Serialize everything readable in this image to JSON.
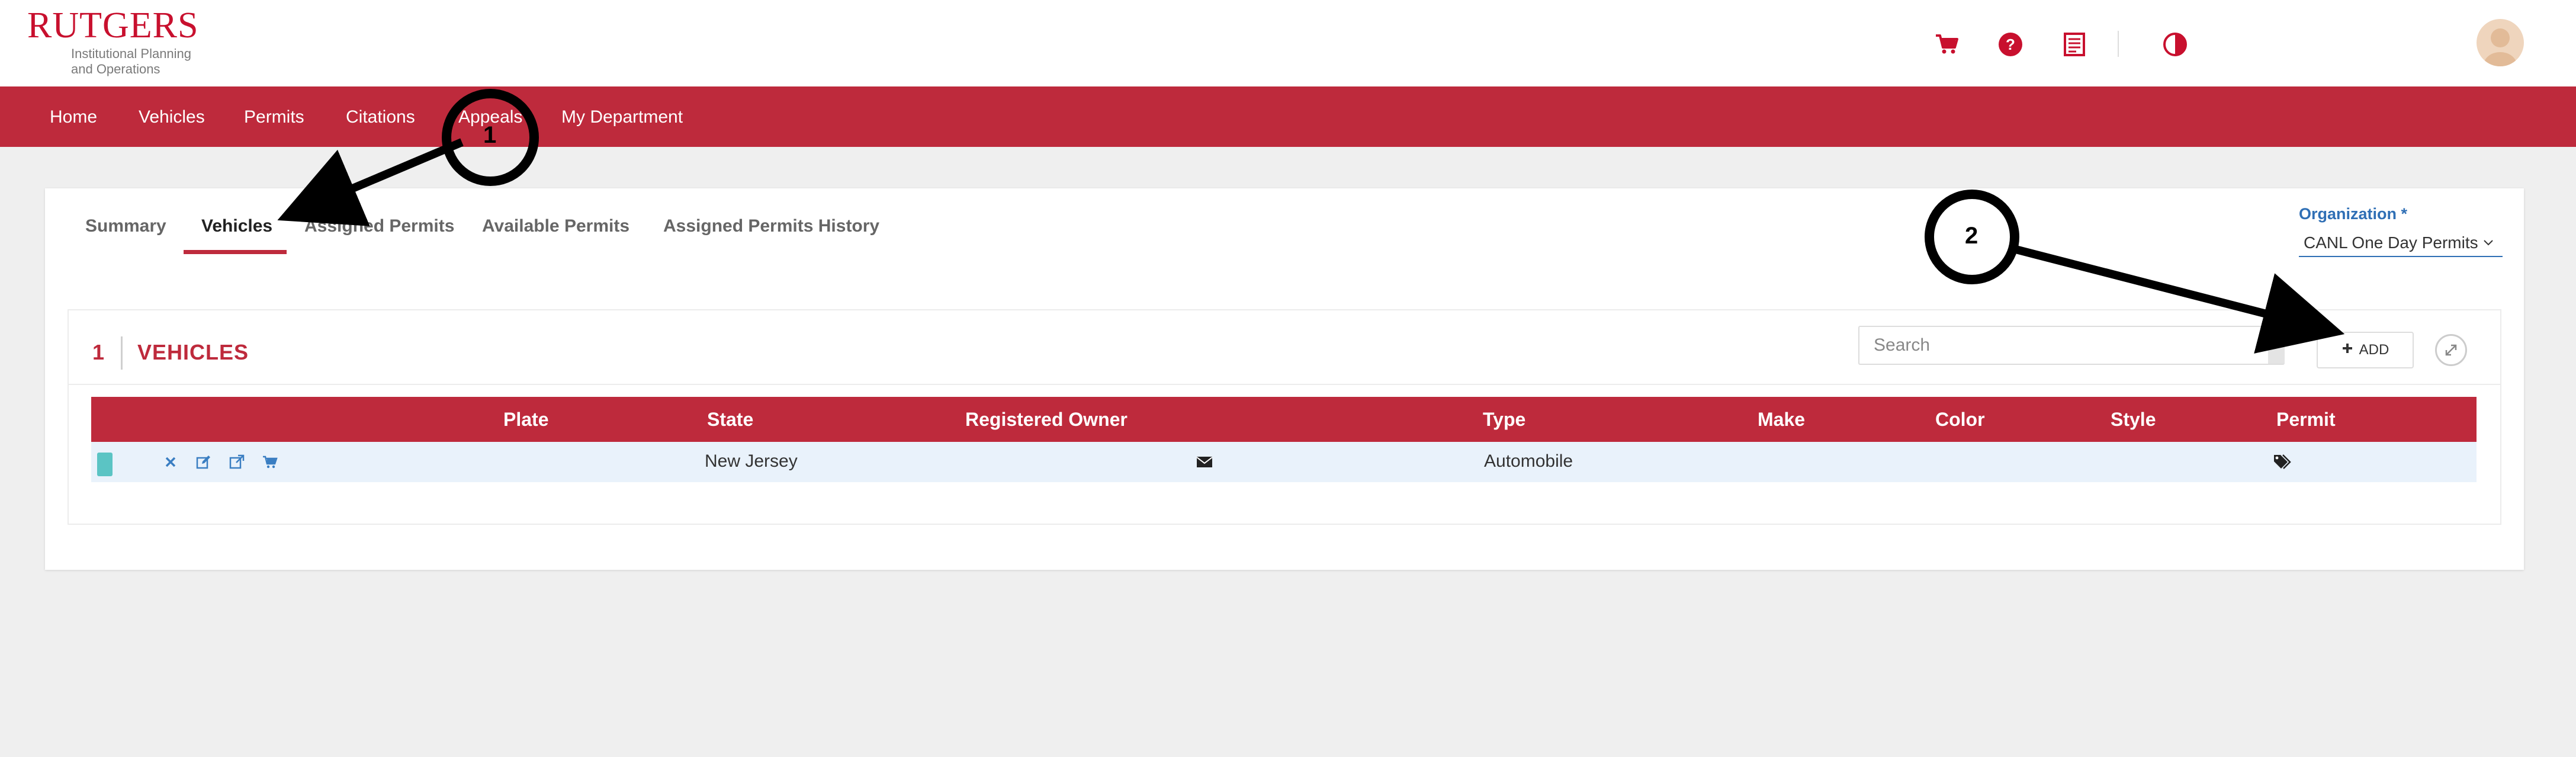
{
  "logo": {
    "main": "RUTGERS",
    "sub_line1": "Institutional Planning",
    "sub_line2": "and Operations"
  },
  "header_icons": [
    "cart-icon",
    "help-icon",
    "receipt-icon",
    "contrast-icon"
  ],
  "nav": [
    "Home",
    "Vehicles",
    "Permits",
    "Citations",
    "Appeals",
    "My Department"
  ],
  "tabs": [
    "Summary",
    "Vehicles",
    "Assigned Permits",
    "Available Permits",
    "Assigned Permits History"
  ],
  "active_tab": "Vehicles",
  "organization": {
    "label": "Organization *",
    "value": "CANL One Day Permits"
  },
  "panel": {
    "count": "1",
    "title": "VEHICLES",
    "search_placeholder": "Search",
    "add_label": "ADD"
  },
  "table": {
    "headers": [
      "Plate",
      "State",
      "Registered Owner",
      "Type",
      "Make",
      "Color",
      "Style",
      "Permit"
    ],
    "rows": [
      {
        "plate": "",
        "state": "New Jersey",
        "owner_icon": "envelope-icon",
        "type": "Automobile",
        "make": "",
        "color": "",
        "style": "",
        "permit_icon": "tags-icon",
        "row_color": "#5bc4c4"
      }
    ]
  },
  "row_actions": [
    "remove-icon",
    "edit-icon",
    "external-link-icon",
    "cart-icon"
  ],
  "annotations": {
    "label1": "1",
    "label2": "2"
  },
  "colors": {
    "brand_red": "#be2a3c",
    "link_blue": "#2f6fb5",
    "row_bg": "#e9f2fb"
  }
}
